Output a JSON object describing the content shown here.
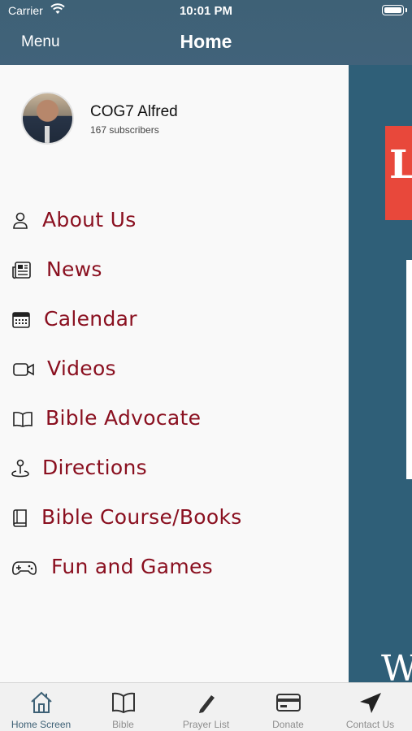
{
  "status_bar": {
    "carrier": "Carrier",
    "time": "10:01 PM"
  },
  "nav": {
    "menu_label": "Menu",
    "title": "Home"
  },
  "profile": {
    "name": "COG7 Alfred",
    "subscribers": "167 subscribers"
  },
  "menu": {
    "items": [
      {
        "label": "About Us",
        "icon": "person-icon"
      },
      {
        "label": "News",
        "icon": "newspaper-icon"
      },
      {
        "label": "Calendar",
        "icon": "calendar-icon"
      },
      {
        "label": "Videos",
        "icon": "video-camera-icon"
      },
      {
        "label": "Bible Advocate",
        "icon": "open-book-icon"
      },
      {
        "label": "Directions",
        "icon": "map-pin-icon"
      },
      {
        "label": "Bible Course/Books",
        "icon": "book-icon"
      },
      {
        "label": "Fun and Games",
        "icon": "gamepad-icon"
      }
    ]
  },
  "tabs": [
    {
      "label": "Home Screen",
      "icon": "home-icon",
      "active": true
    },
    {
      "label": "Bible",
      "icon": "book-icon"
    },
    {
      "label": "Prayer List",
      "icon": "pencil-icon"
    },
    {
      "label": "Donate",
      "icon": "credit-card-icon"
    },
    {
      "label": "Contact Us",
      "icon": "send-icon"
    }
  ],
  "colors": {
    "header": "#41627a",
    "accent": "#8a1020",
    "drawer": "#f9f9f9",
    "background": "#2f5f78"
  }
}
